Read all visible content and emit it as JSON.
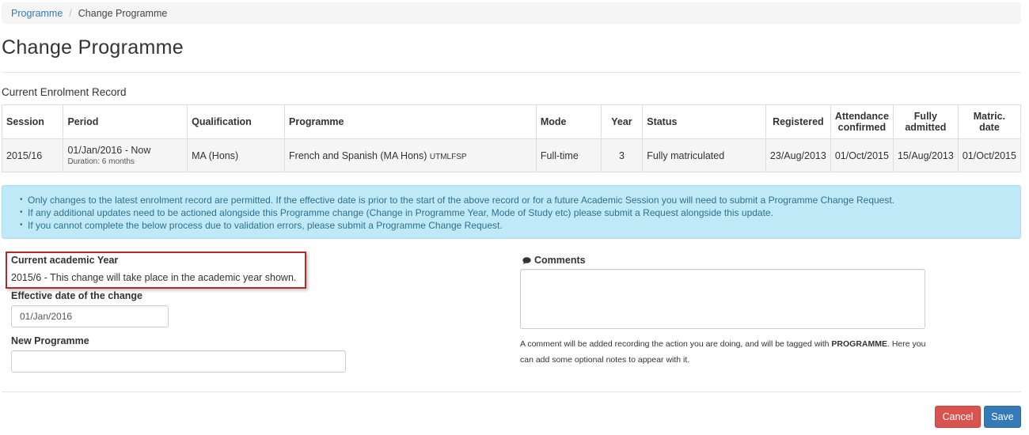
{
  "breadcrumb": {
    "parent": "Programme",
    "separator": "/",
    "current": "Change Programme"
  },
  "page_title": "Change Programme",
  "enrolment_section_label": "Current Enrolment Record",
  "table": {
    "headers": [
      "Session",
      "Period",
      "Qualification",
      "Programme",
      "Mode",
      "Year",
      "Status",
      "Registered",
      "Attendance confirmed",
      "Fully admitted",
      "Matric. date"
    ],
    "row": {
      "session": "2015/16",
      "period": "01/Jan/2016 - Now",
      "duration": "Duration: 6 months",
      "qualification": "MA (Hons)",
      "programme": "French and Spanish (MA Hons)",
      "programme_code": "UTMLFSP",
      "mode": "Full-time",
      "year": "3",
      "status": "Fully matriculated",
      "registered": "23/Aug/2013",
      "attendance_confirmed": "01/Oct/2015",
      "fully_admitted": "15/Aug/2013",
      "matric_date": "01/Oct/2015"
    }
  },
  "alert_items": [
    "Only changes to the latest enrolment record are permitted. If the effective date is prior to the start of the above record or for a future Academic Session you will need to submit a Programme Change Request.",
    "If any additional updates need to be actioned alongside this Programme change (Change in Programme Year, Mode of Study etc) please submit a Request alongside this update.",
    "If you cannot complete the below process due to validation errors, please submit a Programme Change Request."
  ],
  "form": {
    "academic_year_label": "Current academic Year",
    "academic_year_text": "2015/6 - This change will take place in the academic year shown.",
    "effective_date_label": "Effective date of the change",
    "effective_date_value": "01/Jan/2016",
    "new_programme_label": "New Programme",
    "new_programme_value": "",
    "comments_label": "Comments",
    "help_prefix": "A comment will be added recording the action you are doing, and will be tagged with ",
    "help_tag": "PROGRAMME",
    "help_suffix": ". Here you can add some optional notes to appear with it."
  },
  "buttons": {
    "cancel": "Cancel",
    "save": "Save"
  },
  "colors": {
    "link": "#337ab7",
    "alert_bg": "#bfe9f7",
    "highlight_border": "#b22a2a",
    "cancel": "#d9534f",
    "save": "#337ab7"
  },
  "icons": {
    "comments": "comment-icon"
  }
}
